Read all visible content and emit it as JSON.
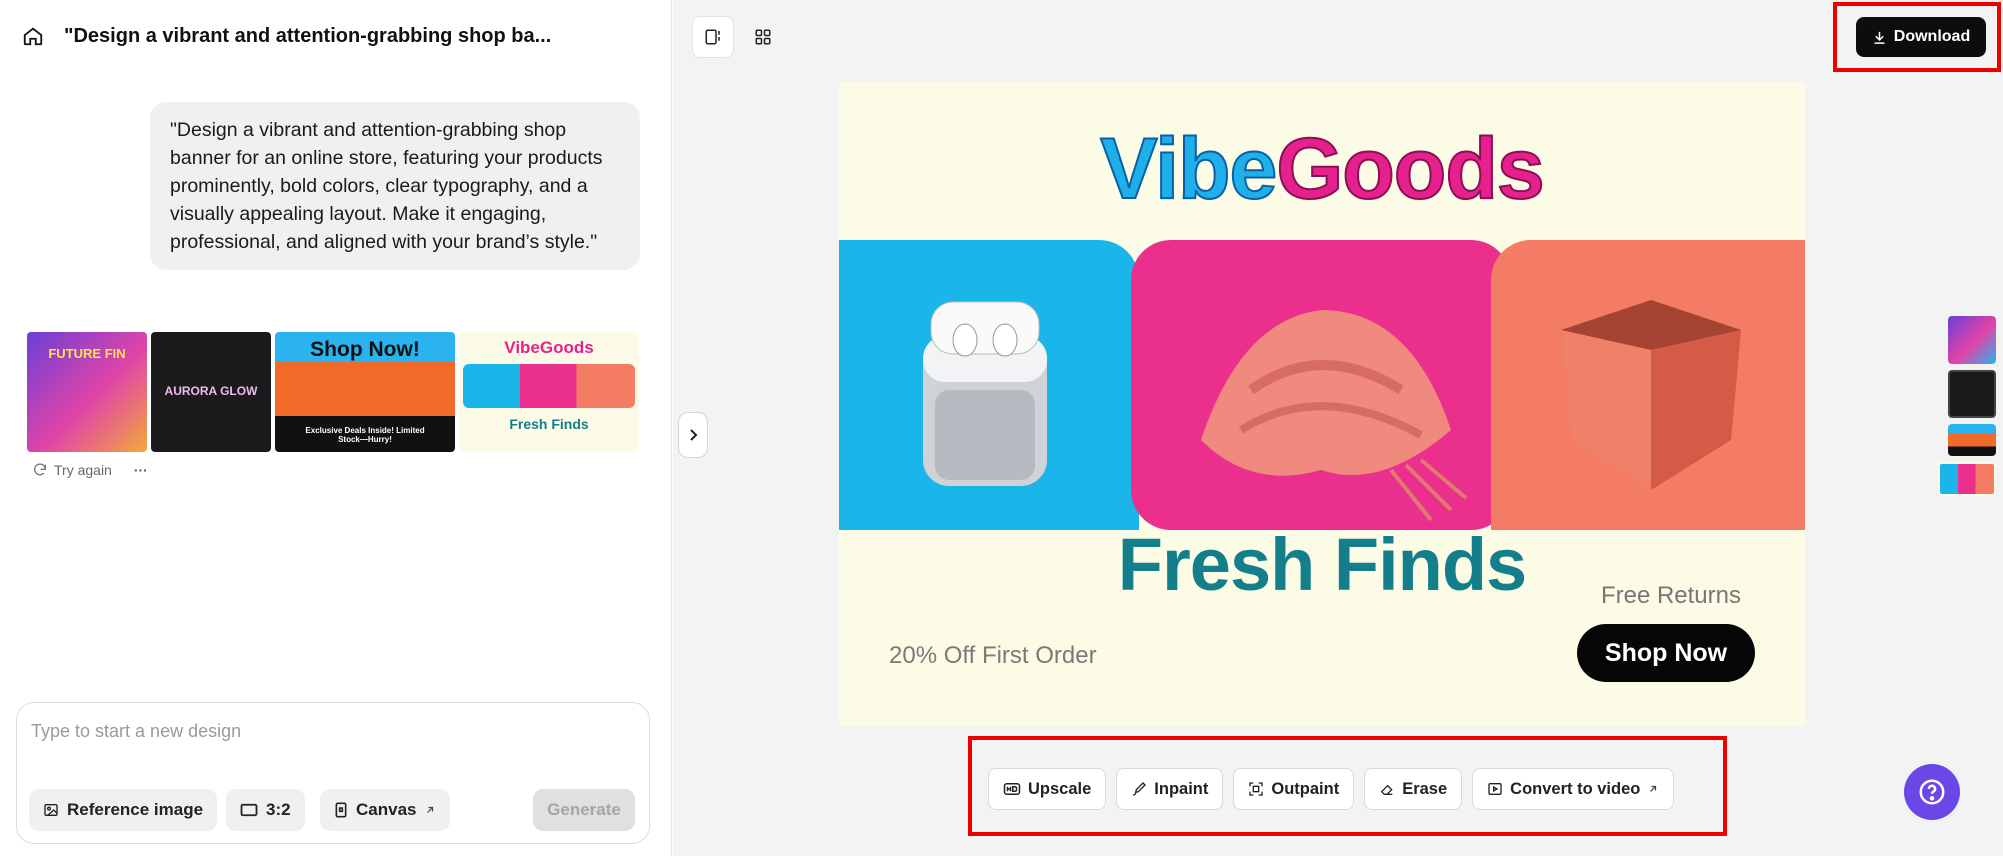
{
  "header": {
    "title": "\"Design a vibrant and attention-grabbing shop ba..."
  },
  "prompt": {
    "text": "\"Design a vibrant and attention-grabbing shop banner for an online store, featuring your products prominently, bold colors, clear typography, and a visually appealing layout. Make it engaging, professional, and aligned with your brand’s style.\""
  },
  "thumbnails": [
    {
      "text": "FUTURE FIN"
    },
    {
      "text": "AURORA GLOW"
    },
    {
      "text": "Shop Now!",
      "sub": "Exclusive Deals Inside! Limited Stock—Hurry!"
    },
    {
      "text": "VibeGoods",
      "sub": "Fresh Finds"
    }
  ],
  "actions": {
    "try_again": "Try again",
    "more": "···"
  },
  "composer": {
    "placeholder": "Type to start a new design",
    "reference_image": "Reference image",
    "ratio": "3:2",
    "canvas": "Canvas",
    "generate": "Generate"
  },
  "toolbar": {
    "download": "Download"
  },
  "banner": {
    "brand_a": "Vibe",
    "brand_b": "Goods",
    "headline": "Fresh Finds",
    "free_returns": "Free Returns",
    "offer": "20% Off First Order",
    "cta": "Shop Now"
  },
  "tools": {
    "upscale": "Upscale",
    "inpaint": "Inpaint",
    "outpaint": "Outpaint",
    "erase": "Erase",
    "video": "Convert to video"
  },
  "colors": {
    "accent": "#6c47e8",
    "highlight": "#e00000",
    "brand_blue": "#1fb0ea",
    "brand_pink": "#e6218d",
    "teal": "#137f8a"
  }
}
